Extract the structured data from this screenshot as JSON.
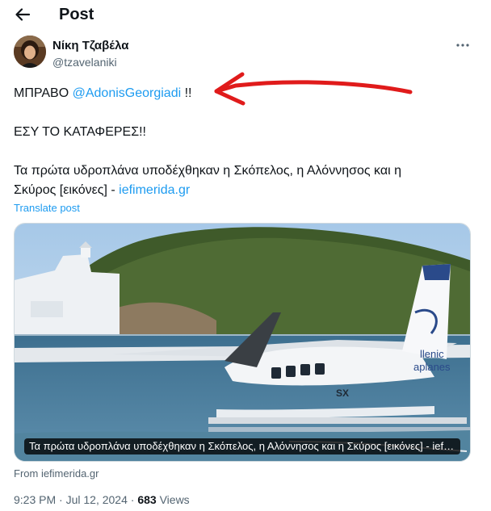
{
  "header": {
    "title": "Post"
  },
  "author": {
    "display_name": "Νίκη Τζαβέλα",
    "handle": "@tzavelaniki"
  },
  "tweet": {
    "line1_prefix": "ΜΠΡΑΒΟ ",
    "mention": "@AdonisGeorgiadi",
    "line1_suffix": " !!",
    "line2": "ΕΣΥ ΤΟ ΚΑΤΑΦΕΡΕΣ!!",
    "line3": "Τα πρώτα υδροπλάνα υποδέχθηκαν η Σκόπελος, η Αλόννησος και η",
    "line4_text": "Σκύρος [εικόνες] - ",
    "line4_link": "iefimerida.gr",
    "translate": "Translate post"
  },
  "card": {
    "caption": "Τα πρώτα υδροπλάνα υποδέχθηκαν η Σκόπελος, η Αλόννησος και η Σκύρος [εικόνες] - iefimerida.gr",
    "tail_text_1": "llenic",
    "tail_text_2": "aplanes",
    "fuselage_text": "SX",
    "source": "From iefimerida.gr"
  },
  "meta": {
    "time": "9:23 PM",
    "separator": " · ",
    "date": "Jul 12, 2024",
    "views_count": "683",
    "views_label": " Views"
  },
  "colors": {
    "link": "#1d9bf0",
    "annotation_arrow": "#e01b1b"
  }
}
